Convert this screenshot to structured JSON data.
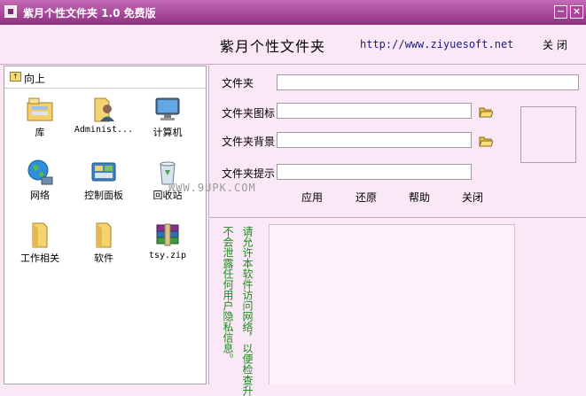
{
  "window": {
    "title": "紫月个性文件夹 1.0 免费版",
    "minimize_glyph": "−",
    "close_glyph": "×"
  },
  "header": {
    "app_title": "紫月个性文件夹",
    "url": "http://www.ziyuesoft.net",
    "close_label": "关 闭"
  },
  "browser": {
    "up_label": "向上",
    "items": [
      {
        "label": "库",
        "icon": "library-icon"
      },
      {
        "label": "Administ...",
        "icon": "user-folder-icon"
      },
      {
        "label": "计算机",
        "icon": "computer-icon"
      },
      {
        "label": "网络",
        "icon": "network-icon"
      },
      {
        "label": "控制面板",
        "icon": "control-panel-icon"
      },
      {
        "label": "回收站",
        "icon": "recycle-bin-icon"
      },
      {
        "label": "工作相关",
        "icon": "folder-icon"
      },
      {
        "label": "软件",
        "icon": "folder-icon"
      },
      {
        "label": "tsy.zip",
        "icon": "zip-archive-icon"
      }
    ]
  },
  "form": {
    "folder_label": "文件夹",
    "folder_value": "",
    "icon_label": "文件夹图标",
    "icon_value": "",
    "background_label": "文件夹背景",
    "background_value": "",
    "tip_label": "文件夹提示",
    "tip_value": "",
    "apply_label": "应用",
    "restore_label": "还原",
    "help_label": "帮助",
    "close_label": "关闭"
  },
  "watermark": "WWW.9UPK.COM",
  "notice": {
    "line1": "请允许本软件访问网络，以便检查升",
    "line2": "不会泄露任何用户隐私信息。"
  },
  "colors": {
    "titlebar": "#a84798",
    "background": "#fbe8f7",
    "notice_text": "#1a8a1a"
  }
}
